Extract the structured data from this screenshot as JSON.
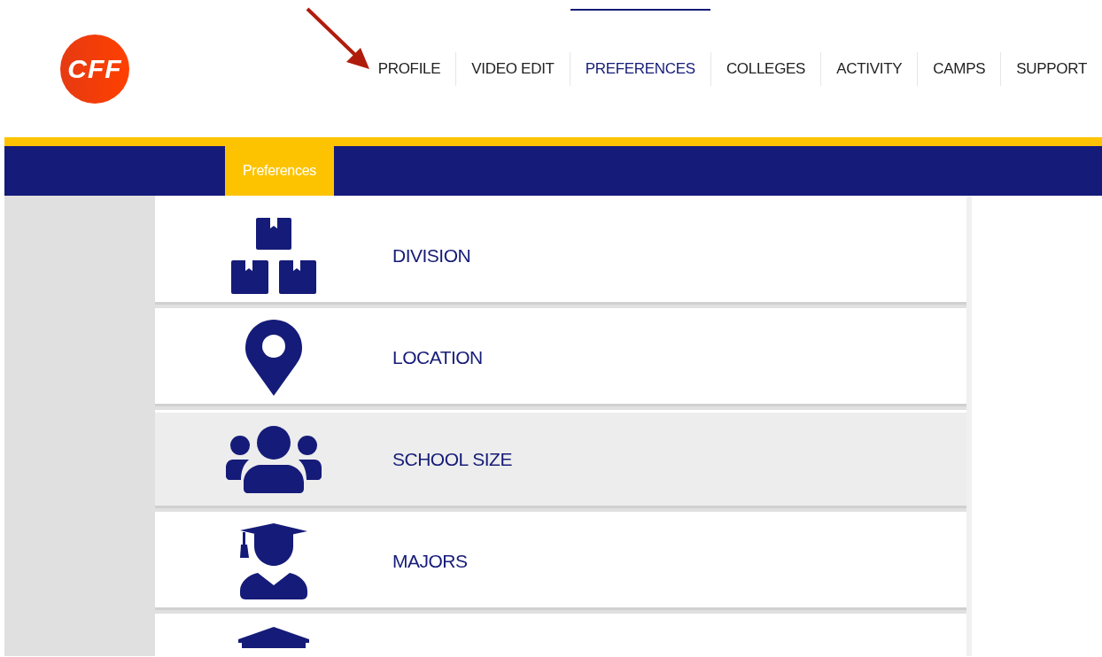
{
  "logo": {
    "text": "CFF"
  },
  "nav": [
    {
      "label": "PROFILE",
      "selected": false
    },
    {
      "label": "VIDEO EDIT",
      "selected": false
    },
    {
      "label": "PREFERENCES",
      "selected": true
    },
    {
      "label": "COLLEGES",
      "selected": false
    },
    {
      "label": "ACTIVITY",
      "selected": false
    },
    {
      "label": "CAMPS",
      "selected": false
    },
    {
      "label": "SUPPORT",
      "selected": false
    }
  ],
  "subnav": [
    {
      "label": "Preferences",
      "selected": true
    }
  ],
  "preferences": [
    {
      "kind": "boxes",
      "label": "DIVISION",
      "selected": false
    },
    {
      "kind": "pin",
      "label": "LOCATION",
      "selected": false
    },
    {
      "kind": "group",
      "label": "SCHOOL SIZE",
      "selected": true
    },
    {
      "kind": "graduate",
      "label": "MAJORS",
      "selected": false
    },
    {
      "kind": "building",
      "selected": false
    }
  ]
}
